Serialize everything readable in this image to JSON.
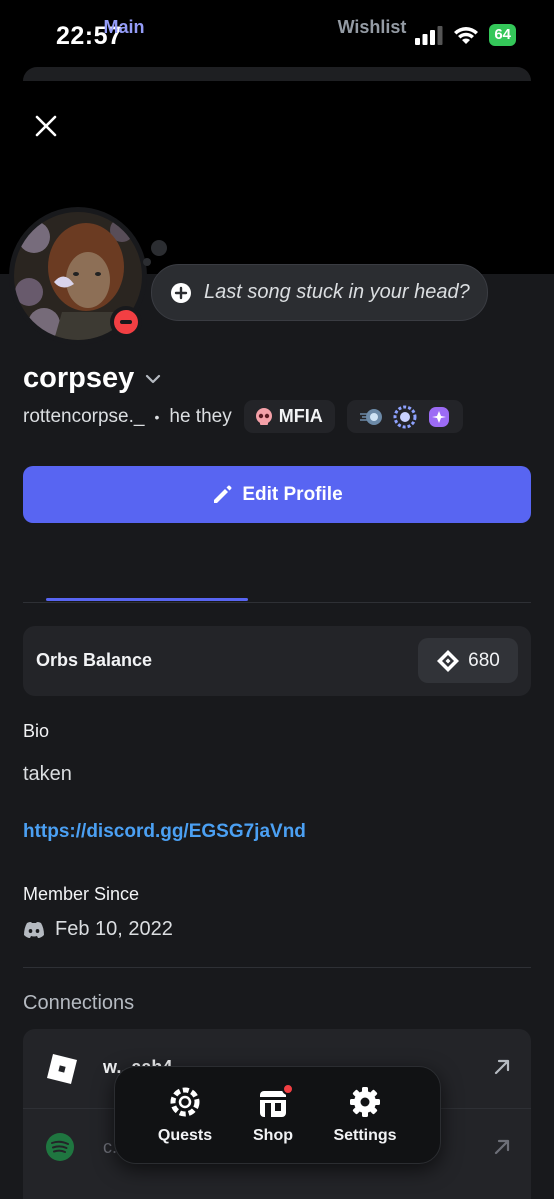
{
  "status_bar": {
    "time": "22:57",
    "battery": "64"
  },
  "profile": {
    "custom_status_placeholder": "Last song stuck in your head?",
    "display_name": "corpsey",
    "username": "rottencorpse._",
    "separator": "•",
    "pronouns": "he they",
    "tag": "MFIA",
    "edit_button": "Edit Profile"
  },
  "tabs": [
    {
      "label": "Main",
      "active": true
    },
    {
      "label": "Wishlist",
      "active": false
    }
  ],
  "orbs": {
    "label": "Orbs Balance",
    "value": "680"
  },
  "bio": {
    "label": "Bio",
    "text": "taken",
    "link": "https://discord.gg/EGSG7jaVnd"
  },
  "member_since": {
    "label": "Member Since",
    "date": "Feb 10, 2022"
  },
  "connections": {
    "label": "Connections",
    "items": [
      {
        "service": "roblox",
        "name": "w...aah4"
      },
      {
        "service": "spotify",
        "name": "c..."
      }
    ]
  },
  "bottom_nav": [
    {
      "label": "Quests",
      "icon": "quests-icon"
    },
    {
      "label": "Shop",
      "icon": "shop-icon",
      "badge": true
    },
    {
      "label": "Settings",
      "icon": "gear-icon"
    }
  ],
  "colors": {
    "accent": "#5865f2",
    "tab_active": "#949cf7",
    "link": "#4ba0f3",
    "dnd_status": "#f23f43",
    "battery": "#34c759"
  }
}
